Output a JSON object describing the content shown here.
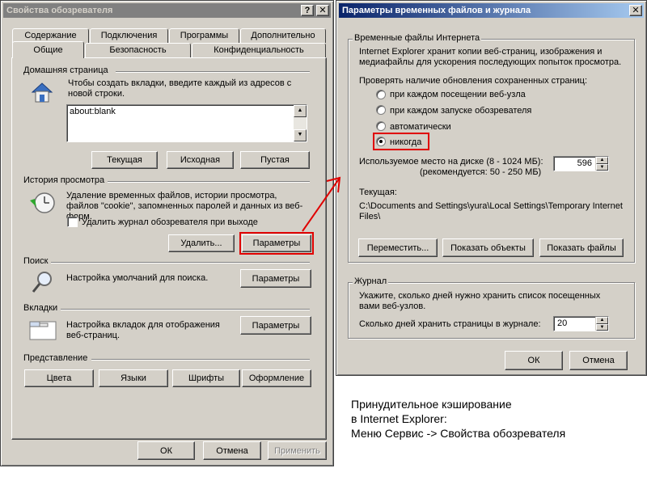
{
  "left_window": {
    "title": "Свойства обозревателя",
    "caption_help": "?",
    "caption_close": "✕",
    "tabs_row1": [
      "Содержание",
      "Подключения",
      "Программы",
      "Дополнительно"
    ],
    "tabs_row2": [
      "Общие",
      "Безопасность",
      "Конфиденциальность"
    ],
    "home": {
      "title": "Домашняя страница",
      "desc": "Чтобы создать вкладки, введите каждый из адресов с новой строки.",
      "url": "about:blank",
      "btn_current": "Текущая",
      "btn_default": "Исходная",
      "btn_blank": "Пустая"
    },
    "history": {
      "title": "История просмотра",
      "desc": "Удаление временных файлов, истории просмотра, файлов \"cookie\", запомненных паролей и данных из веб-форм.",
      "checkbox_label": "Удалить журнал обозревателя при выходе",
      "btn_delete": "Удалить...",
      "btn_settings": "Параметры"
    },
    "search": {
      "title": "Поиск",
      "desc": "Настройка умолчаний для поиска.",
      "btn_settings": "Параметры"
    },
    "tabs": {
      "title": "Вкладки",
      "desc": "Настройка вкладок для отображения веб-страниц.",
      "btn_settings": "Параметры"
    },
    "appearance": {
      "title": "Представление",
      "btn_colors": "Цвета",
      "btn_languages": "Языки",
      "btn_fonts": "Шрифты",
      "btn_design": "Оформление"
    },
    "footer": {
      "ok": "ОК",
      "cancel": "Отмена",
      "apply": "Применить"
    }
  },
  "right_window": {
    "title": "Параметры временных файлов и журнала",
    "caption_close": "✕",
    "temp_group": {
      "legend": "Временные файлы Интернета",
      "desc": "Internet Explorer хранит копии веб-страниц, изображения и медиафайлы для ускорения последующих попыток просмотра.",
      "check_label": "Проверять наличие обновления сохраненных страниц:",
      "options": [
        "при каждом посещении веб-узла",
        "при каждом запуске обозревателя",
        "автоматически",
        "никогда"
      ],
      "selected_index": 3,
      "disk_label_1": "Используемое место на диске (8 - 1024 МБ):",
      "disk_label_2": "(рекомендуется: 50 - 250 МБ)",
      "disk_value": "596",
      "current_label": "Текущая:",
      "current_path": "C:\\Documents and Settings\\yura\\Local Settings\\Temporary Internet Files\\",
      "btn_move": "Переместить...",
      "btn_objects": "Показать объекты",
      "btn_files": "Показать файлы"
    },
    "journal_group": {
      "legend": "Журнал",
      "desc": "Укажите, сколько дней нужно хранить список посещенных вами веб-узлов.",
      "days_label": "Сколько дней хранить страницы в журнале:",
      "days_value": "20"
    },
    "footer": {
      "ok": "ОК",
      "cancel": "Отмена"
    }
  },
  "caption": {
    "line1": "Принудительное кэширование",
    "line2": "в Internet Explorer:",
    "line3": "Меню Сервис -> Свойства обозревателя"
  },
  "colors": {
    "highlight": "#e00000",
    "active_title": "#0a246a",
    "inactive_title": "#808080",
    "face": "#d4d0c8"
  }
}
